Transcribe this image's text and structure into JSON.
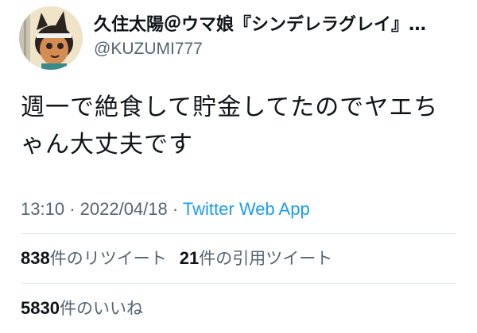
{
  "tweet": {
    "author": {
      "display_name": "久住太陽＠ウマ娘『シンデレラグレイ』単…",
      "handle": "@KUZUMI777",
      "avatar_icon": "avatar-illustration-icon"
    },
    "text_lines": [
      "週一で絶食して貯金してたのでヤエち",
      "ゃん大丈夫です"
    ],
    "time": "13:10",
    "separator": "·",
    "date": "2022/04/18",
    "source": "Twitter Web App",
    "retweets": {
      "count": "838",
      "label": "件のリツイート"
    },
    "quotes": {
      "count": "21",
      "label": "件の引用ツイート"
    },
    "likes": {
      "count": "5830",
      "label": "件のいいね"
    }
  },
  "colors": {
    "text": "#0f1419",
    "secondary": "#536471",
    "link": "#1d9bf0",
    "divider": "#e6ecf0"
  }
}
